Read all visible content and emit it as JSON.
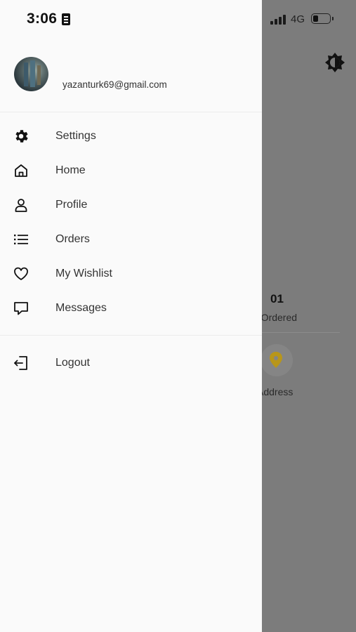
{
  "status_bar": {
    "time": "3:06",
    "network": "4G"
  },
  "user": {
    "email": "yazanturk69@gmail.com"
  },
  "menu": {
    "items": [
      {
        "label": "Settings",
        "icon": "gear-icon"
      },
      {
        "label": "Home",
        "icon": "home-icon"
      },
      {
        "label": "Profile",
        "icon": "user-icon"
      },
      {
        "label": "Orders",
        "icon": "list-icon"
      },
      {
        "label": "My Wishlist",
        "icon": "heart-icon"
      },
      {
        "label": "Messages",
        "icon": "message-icon"
      }
    ],
    "logout_label": "Logout"
  },
  "background": {
    "ordered_count": "01",
    "ordered_label": "n Ordered",
    "address_label": "Address"
  },
  "colors": {
    "drawer_bg": "#fafafa",
    "overlay": "#7c7c7c",
    "accent": "#b8961a"
  }
}
